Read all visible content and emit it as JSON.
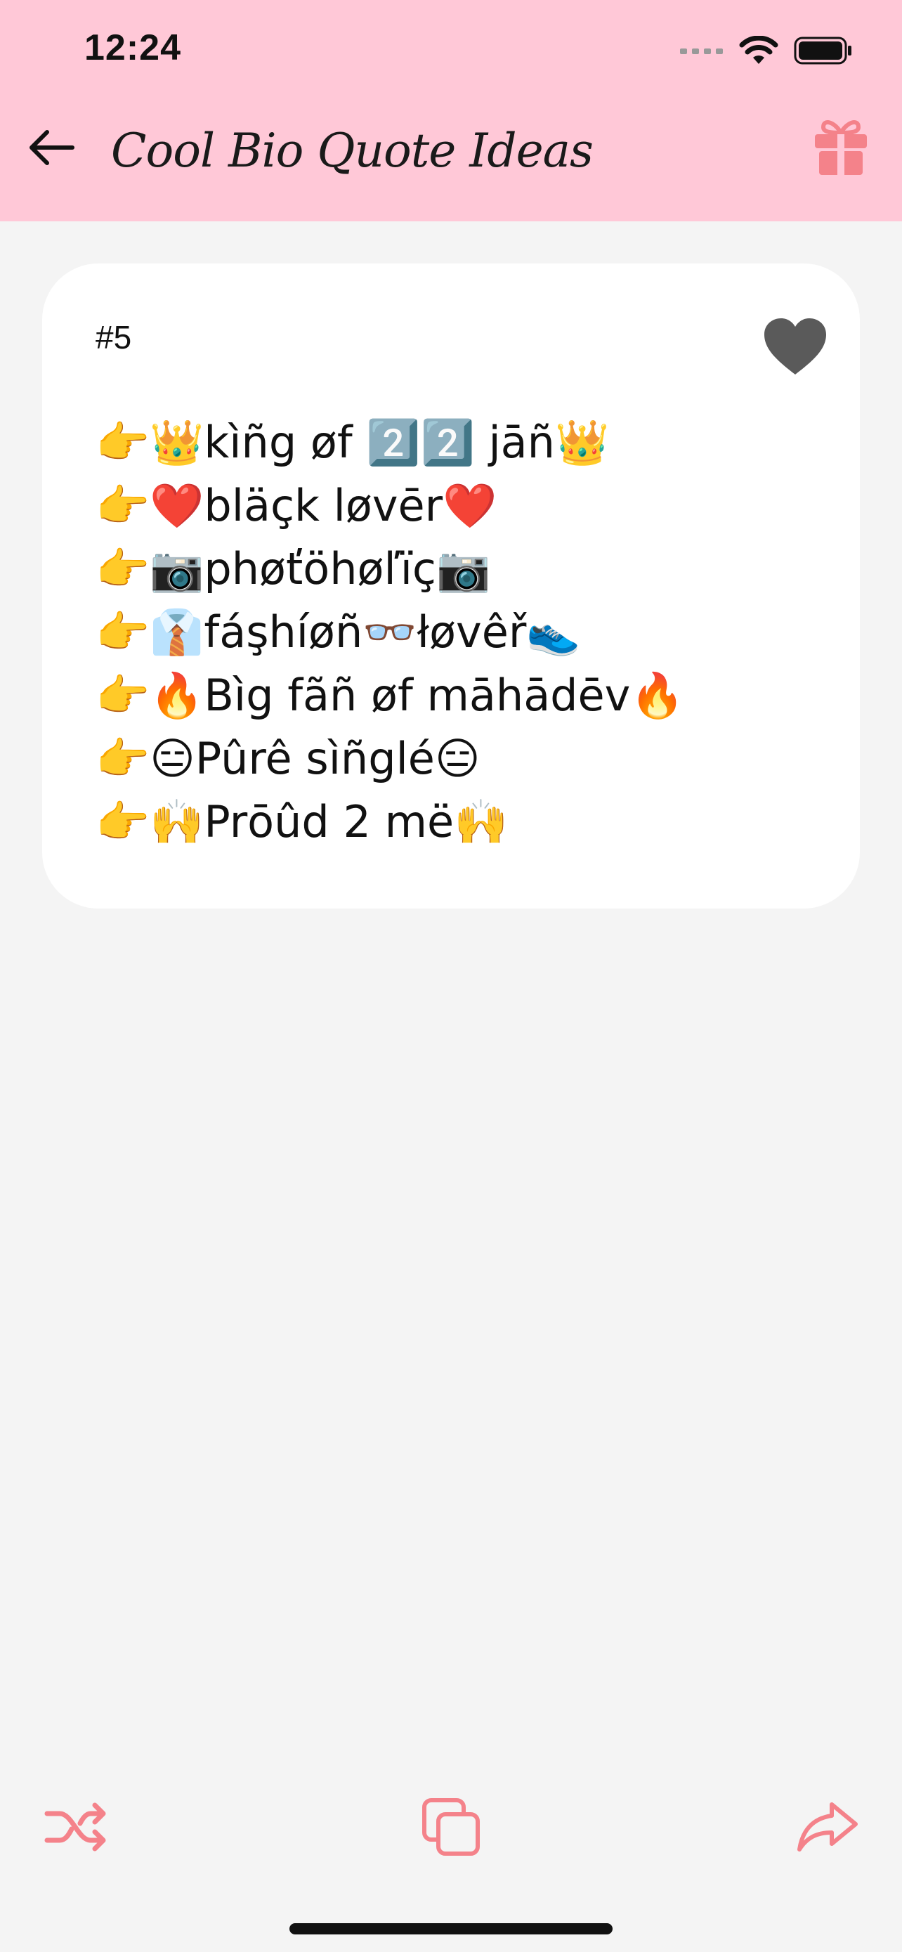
{
  "status_bar": {
    "time": "12:24"
  },
  "header": {
    "title": "Cool Bio Quote Ideas",
    "back_icon": "arrow-left-icon",
    "gift_icon": "gift-icon"
  },
  "quote": {
    "number": "#5",
    "favorite_icon": "heart-icon",
    "lines": [
      "👉👑kìñg øf 2️⃣2️⃣ jāñ👑",
      "👉❤️bläçk løvēr❤️",
      "👉📷phøťöhøľïç📷",
      "👉👔fáşhíøñ👓łøvêř👟",
      "👉🔥Bìg fãñ øf māhādēv🔥",
      "👉😑Pûrê sìñglé😑",
      "👉🙌Prōûd 2 më🙌"
    ]
  },
  "bottom_bar": {
    "shuffle_icon": "shuffle-icon",
    "copy_icon": "copy-icon",
    "share_icon": "share-icon"
  },
  "colors": {
    "header_bg": "#ffc8d7",
    "accent": "#f4828a",
    "page_bg": "#f4f4f4",
    "heart": "#5a5a5a"
  }
}
